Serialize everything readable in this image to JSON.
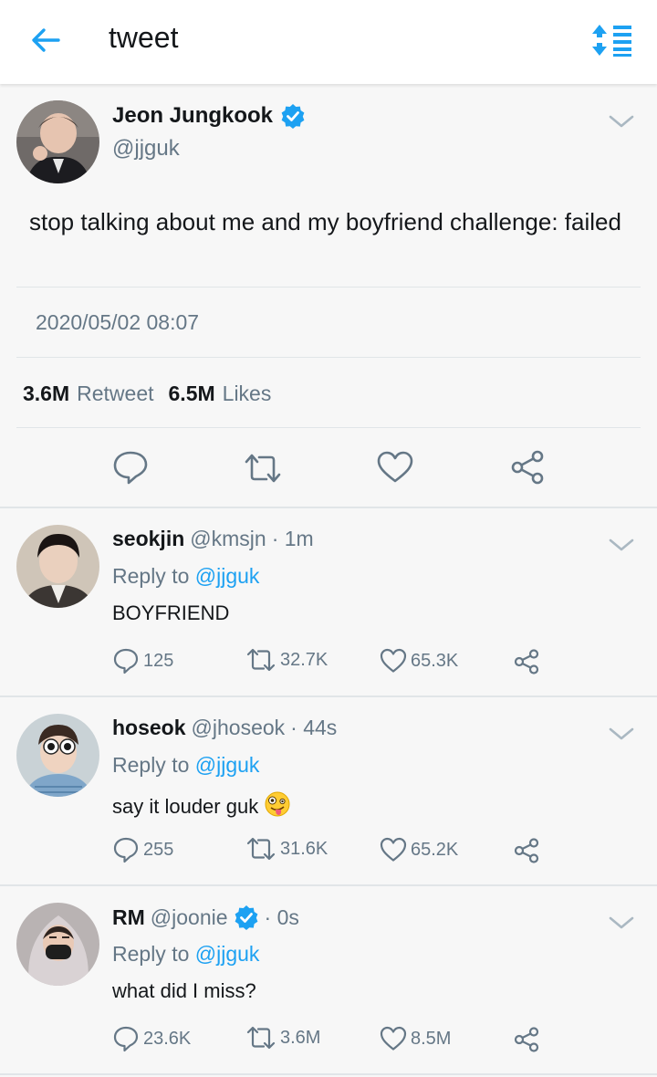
{
  "header": {
    "title": "tweet",
    "back_icon": "arrow-left-icon",
    "sort_icon": "sort-list-icon",
    "accent_color": "#1da1f2"
  },
  "main_tweet": {
    "author_name": "Jeon Jungkook",
    "handle": "@jjguk",
    "verified": true,
    "text": "stop talking about me and my boyfriend challenge: failed",
    "datetime": "2020/05/02 08:07",
    "retweets_count": "3.6M",
    "retweets_label": "Retweet",
    "likes_count": "6.5M",
    "likes_label": "Likes"
  },
  "replies": [
    {
      "name": "seokjin",
      "handle": "@kmsjn",
      "time": "· 1m",
      "verified": false,
      "reply_to_prefix": "Reply to",
      "reply_to_handle": "@jjguk",
      "text": "BOYFRIEND",
      "replies": "125",
      "retweets": "32.7K",
      "likes": "65.3K"
    },
    {
      "name": "hoseok",
      "handle": "@jhoseok",
      "time": "· 44s",
      "verified": false,
      "reply_to_prefix": "Reply to",
      "reply_to_handle": "@jjguk",
      "text": "say it louder guk",
      "emoji": "zany-face-emoji",
      "replies": "255",
      "retweets": "31.6K",
      "likes": "65.2K"
    },
    {
      "name": "RM",
      "handle": "@joonie",
      "time": "· 0s",
      "verified": true,
      "reply_to_prefix": "Reply to",
      "reply_to_handle": "@jjguk",
      "text": "what did I miss?",
      "replies": "23.6K",
      "retweets": "3.6M",
      "likes": "8.5M"
    }
  ]
}
